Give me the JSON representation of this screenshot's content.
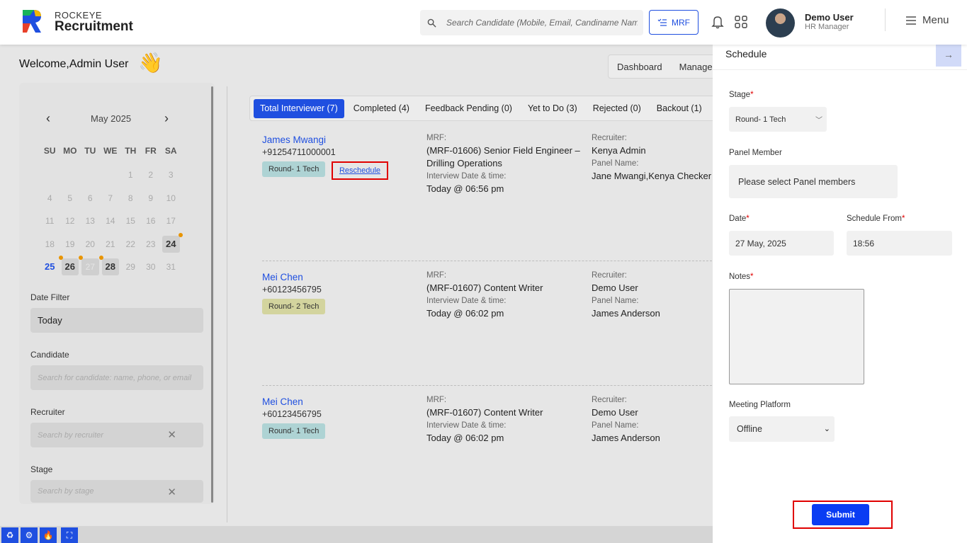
{
  "brand": {
    "top": "ROCKEYE",
    "main": "Recruitment"
  },
  "header": {
    "search_placeholder": "Search Candidate (Mobile, Email, Candiname Name)",
    "mrf_label": "MRF",
    "user_name": "Demo User",
    "user_role": "HR Manager",
    "menu_label": "Menu"
  },
  "welcome": {
    "prefix": "Welcome,",
    "name": "Admin User",
    "emoji": "👋"
  },
  "top_tabs": [
    "Dashboard",
    "Managem"
  ],
  "calendar": {
    "title": "May 2025",
    "dow": [
      "SU",
      "MO",
      "TU",
      "WE",
      "TH",
      "FR",
      "SA"
    ],
    "weeks": [
      [
        "",
        "",
        "",
        "",
        "1",
        "2",
        "3"
      ],
      [
        "4",
        "5",
        "6",
        "7",
        "8",
        "9",
        "10"
      ],
      [
        "11",
        "12",
        "13",
        "14",
        "15",
        "16",
        "17"
      ],
      [
        "18",
        "19",
        "20",
        "21",
        "22",
        "23",
        "24"
      ],
      [
        "25",
        "26",
        "27",
        "28",
        "29",
        "30",
        "31"
      ]
    ]
  },
  "filters": {
    "date_label": "Date Filter",
    "date_value": "Today",
    "candidate_label": "Candidate",
    "candidate_placeholder": "Search for candidate: name, phone, or email",
    "recruiter_label": "Recruiter",
    "recruiter_placeholder": "Search by recruiter",
    "stage_label": "Stage",
    "stage_placeholder": "Search by stage",
    "clear_glyph": "✕"
  },
  "tabs": [
    "Total Interviewer (7)",
    "Completed (4)",
    "Feedback Pending (0)",
    "Yet to Do (3)",
    "Rejected (0)",
    "Backout (1)"
  ],
  "cards": [
    {
      "name": "James Mwangi",
      "phone": "+91254711000001",
      "stage": "Round- 1 Tech",
      "reschedule": "Reschedule",
      "mrf_label": "MRF:",
      "mrf_value": "(MRF-01606) Senior Field Engineer – Drilling Operations",
      "date_label": "Interview Date & time:",
      "date_value": "Today @ 06:56 pm",
      "recruiter_label": "Recruiter:",
      "recruiter_value": "Kenya Admin",
      "panel_label": "Panel Name:",
      "panel_value": "Jane Mwangi,Kenya Checker"
    },
    {
      "name": "Mei Chen",
      "phone": "+60123456795",
      "stage": "Round- 2 Tech",
      "mrf_label": "MRF:",
      "mrf_value": "(MRF-01607) Content Writer",
      "date_label": "Interview Date & time:",
      "date_value": "Today @ 06:02 pm",
      "recruiter_label": "Recruiter:",
      "recruiter_value": "Demo User",
      "panel_label": "Panel Name:",
      "panel_value": "James Anderson"
    },
    {
      "name": "Mei Chen",
      "phone": "+60123456795",
      "stage": "Round- 1 Tech",
      "mrf_label": "MRF:",
      "mrf_value": "(MRF-01607) Content Writer",
      "date_label": "Interview Date & time:",
      "date_value": "Today @ 06:02 pm",
      "recruiter_label": "Recruiter:",
      "recruiter_value": "Demo User",
      "panel_label": "Panel Name:",
      "panel_value": "James Anderson"
    }
  ],
  "schedule": {
    "title": "Schedule",
    "close_glyph": "→",
    "stage_label": "Stage",
    "stage_value": "Round- 1 Tech",
    "panel_label": "Panel Member",
    "panel_placeholder": "Please select Panel members",
    "date_label": "Date",
    "date_value": "27 May, 2025",
    "from_label": "Schedule From",
    "from_value": "18:56",
    "notes_label": "Notes",
    "platform_label": "Meeting Platform",
    "platform_value": "Offline",
    "required_mark": "*",
    "submit_label": "Submit"
  },
  "colors": {
    "accent": "#1f4fe0",
    "highlight": "#e00000",
    "event_dot": "#e89400"
  }
}
